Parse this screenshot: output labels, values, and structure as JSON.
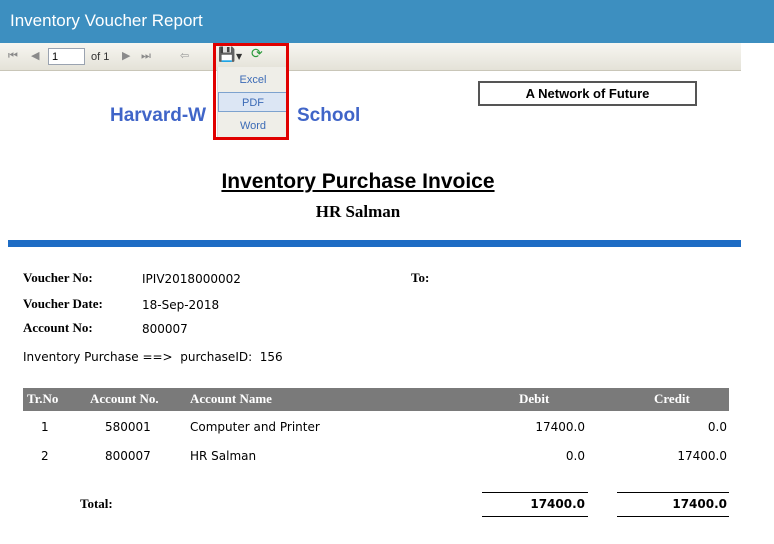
{
  "window": {
    "title": "Inventory Voucher Report"
  },
  "toolbar": {
    "page_value": "1",
    "of_text": "of 1",
    "export_menu": [
      "Excel",
      "PDF",
      "Word"
    ]
  },
  "report": {
    "school_name": "Harvard-W",
    "school_name_end": "School",
    "tagline": "A Network of Future",
    "title": "Inventory Purchase Invoice",
    "subtitle": "HR Salman",
    "voucher_no_label": "Voucher No:",
    "voucher_no": "IPIV2018000002",
    "voucher_date_label": "Voucher Date:",
    "voucher_date": "18-Sep-2018",
    "account_no_label": "Account No:",
    "account_no": "800007",
    "to_label": "To:",
    "purchase_line": "Inventory Purchase ==>  purchaseID:  156",
    "columns": [
      "Tr.No",
      "Account No.",
      "Account Name",
      "Debit",
      "Credit"
    ],
    "rows": [
      [
        "1",
        "580001",
        "Computer and Printer",
        "17400.0",
        "0.0"
      ],
      [
        "2",
        "800007",
        "HR Salman",
        "0.0",
        "17400.0"
      ]
    ],
    "total_label": "Total:",
    "total_debit": "17400.0",
    "total_credit": "17400.0"
  },
  "colors": {
    "titlebar": "#3d8fc0",
    "accent_bar": "#1e6cc4",
    "highlight": "#e00000"
  }
}
